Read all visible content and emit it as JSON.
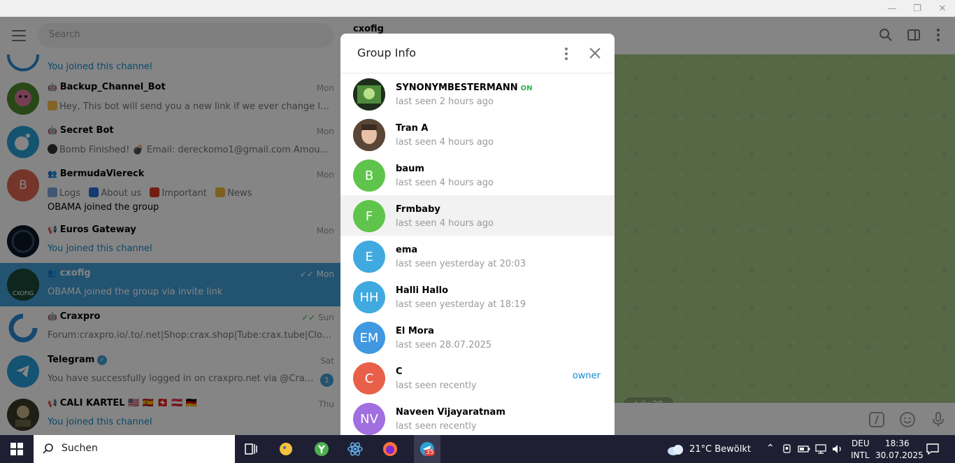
{
  "window": {
    "minimize": "—",
    "restore": "❐",
    "close": "✕"
  },
  "sidebar": {
    "search_placeholder": "Search",
    "chats": [
      {
        "title": "",
        "time": "",
        "line1": "You joined this channel",
        "line2": "",
        "avatar_color": "#2a8bd6"
      },
      {
        "title": "Backup_Channel_Bot",
        "time": "Mon",
        "line1": "Hey, This bot will send you a new link if we ever change location...",
        "line2": "",
        "avatar_color": "#3d6b2a"
      },
      {
        "title": "Secret Bot",
        "time": "Mon",
        "line1": "Bomb Finished! 💣 Email: dereckomo1@gmail.com Amount: 10...",
        "line2": "",
        "avatar_color": "#2aa1d8"
      },
      {
        "title": "BermudaViereck",
        "time": "Mon",
        "line1": "Logs",
        "line1b": "About us",
        "line1c": "Important",
        "line1d": "News",
        "line2": "OBAMA joined the group",
        "avatar_letter": "B",
        "avatar_color": "#e0694f"
      },
      {
        "title": "Euros Gateway",
        "time": "Mon",
        "line1": "You joined this channel",
        "line2": "",
        "avatar_color": "#111d2e"
      },
      {
        "title": "cxofig",
        "time": "Mon",
        "line1": "OBAMA joined the group via invite link",
        "line2": "",
        "avatar_color": "#1b4a3a",
        "avatar_text": "CXOFIG"
      },
      {
        "title": "Craxpro",
        "time": "Sun",
        "line1": "Forum:craxpro.io/.to/.net|Shop:crax.shop|Tube:crax.tube|Cloud:c...",
        "line2": "",
        "avatar_color": "#ffffff"
      },
      {
        "title": "Telegram",
        "time": "Sat",
        "line1": "You have successfully logged in on craxpro.net via @Craxproio...",
        "line2": "",
        "badge": "1",
        "avatar_color": "#2a9fdb"
      },
      {
        "title": "CALI KARTEL 🇺🇸 🇪🇸 🇨🇭 🇦🇹 🇩🇪",
        "time": "Thu",
        "line1": "You joined this channel",
        "line2": "",
        "avatar_color": "#3b3a28"
      }
    ]
  },
  "main": {
    "title": "cxofig",
    "date_pill": "July 28"
  },
  "modal": {
    "title": "Group Info",
    "members": [
      {
        "name": "SYNONYMBESTERMANN",
        "tag": "ON",
        "status": "last seen 2 hours ago",
        "role": "",
        "letters": "",
        "color": "#2e4a2a"
      },
      {
        "name": "Tran A",
        "tag": "",
        "status": "last seen 4 hours ago",
        "role": "",
        "letters": "",
        "color": "#6b4a3a"
      },
      {
        "name": "baum",
        "tag": "",
        "status": "last seen 4 hours ago",
        "role": "",
        "letters": "B",
        "color": "#5fc44b"
      },
      {
        "name": "Frmbaby",
        "tag": "",
        "status": "last seen 4 hours ago",
        "role": "",
        "letters": "F",
        "color": "#5fc44b"
      },
      {
        "name": "ema",
        "tag": "",
        "status": "last seen yesterday at 20:03",
        "role": "",
        "letters": "E",
        "color": "#3fa9e0"
      },
      {
        "name": "Halli Hallo",
        "tag": "",
        "status": "last seen yesterday at 18:19",
        "role": "",
        "letters": "HH",
        "color": "#3fa9e0"
      },
      {
        "name": "El Mora",
        "tag": "",
        "status": "last seen 28.07.2025",
        "role": "",
        "letters": "EM",
        "color": "#3f98e0"
      },
      {
        "name": "C",
        "tag": "",
        "status": "last seen recently",
        "role": "owner",
        "letters": "C",
        "color": "#e9604a"
      },
      {
        "name": "Naveen Vijayaratnam",
        "tag": "",
        "status": "last seen recently",
        "role": "",
        "letters": "NV",
        "color": "#a16fe0"
      }
    ]
  },
  "taskbar": {
    "search_label": "Suchen",
    "weather": "21°C  Bewölkt",
    "lang1": "DEU",
    "lang2": "INTL",
    "time": "18:36",
    "date": "30.07.2025",
    "telegram_badge": "35"
  }
}
